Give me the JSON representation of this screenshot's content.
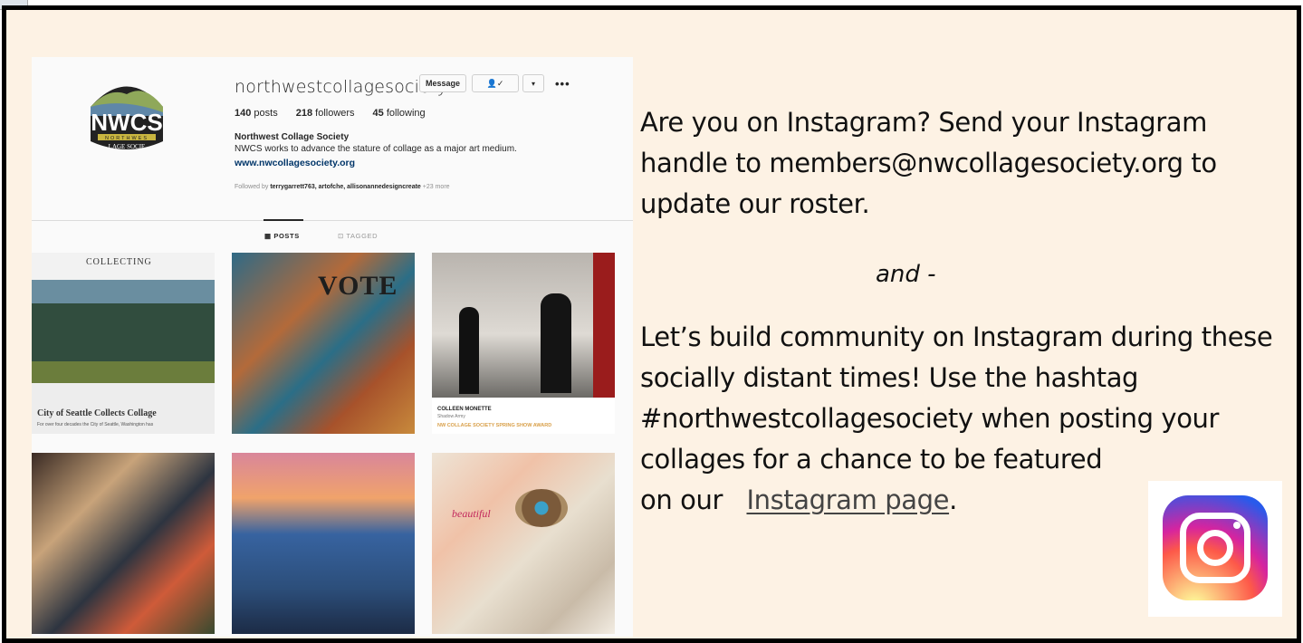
{
  "instagram": {
    "username": "northwestcollagesociety",
    "buttons": {
      "message": "Message",
      "following": "👤✓",
      "dropdown": "▾",
      "more": "•••"
    },
    "stats": {
      "posts": "140",
      "posts_label": "posts",
      "followers": "218",
      "followers_label": "followers",
      "following": "45",
      "following_label": "following"
    },
    "bio_name": "Northwest Collage Society",
    "bio_text": "NWCS works to advance the stature of collage as a major art medium.",
    "bio_link": "www.nwcollagesociety.org",
    "followed_prefix": "Followed by",
    "followed_names": "terrygarrett763, artofche, allisonannedesigncreate",
    "followed_more": "+23 more",
    "tabs": {
      "posts": "▦ POSTS",
      "tagged": "⊡ TAGGED"
    },
    "logo": {
      "text": "NWCS",
      "sub1": "NORTHWES",
      "sub2": "LAGE SOCIE"
    },
    "tiles": {
      "t1_title": "COLLECTING",
      "t1_caption": "City of Seattle Collects Collage",
      "t1_sub": "For over four decades the City of Seattle, Washington has",
      "t2_word": "VOTE",
      "t3_name": "COLLEEN MONETTE",
      "t3_sub": "Shadow Army",
      "t3_award": "NW COLLAGE SOCIETY SPRING SHOW AWARD",
      "t6_word": "beautiful"
    }
  },
  "copy": {
    "p1": "Are you on Instagram? Send your Instagram handle to members@nwcollagesociety.org to update our roster.",
    "and": "and -",
    "p2_a": "Let’s build community on Instagram during these socially distant times! Use the hashtag #northwestcollagesociety when posting your collages  for a chance to be featured",
    "p2_b": "on our",
    "link": "Instagram page",
    "p2_end": "."
  },
  "colors": {
    "background": "#fdf2e4",
    "frame": "#000000",
    "link": "#444444"
  }
}
